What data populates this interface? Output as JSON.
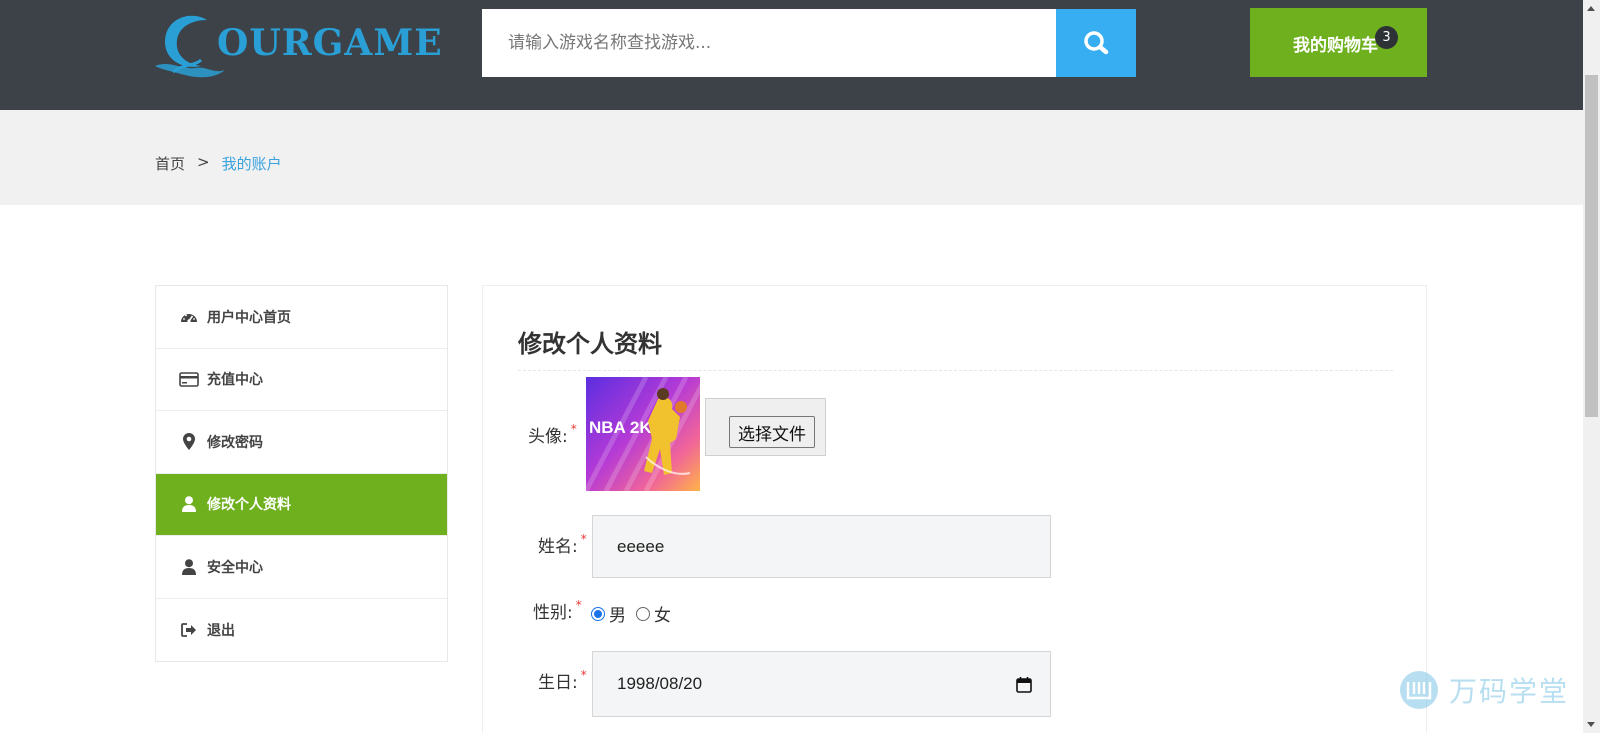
{
  "header": {
    "logo_text": "OURGAME",
    "search_placeholder": "请输入游戏名称查找游戏...",
    "cart_label": "我的购物车",
    "cart_count": "3",
    "brand_blue": "#37aef2",
    "brand_green": "#6fb01f",
    "header_bg": "#3c4248"
  },
  "breadcrumb": {
    "home": "首页",
    "separator": ">",
    "current": "我的账户"
  },
  "sidebar": {
    "items": [
      {
        "label": "用户中心首页",
        "icon": "dashboard-icon",
        "active": false
      },
      {
        "label": "充值中心",
        "icon": "credit-card-icon",
        "active": false
      },
      {
        "label": "修改密码",
        "icon": "map-marker-icon",
        "active": false
      },
      {
        "label": "修改个人资料",
        "icon": "user-icon",
        "active": true
      },
      {
        "label": "安全中心",
        "icon": "user-icon",
        "active": false
      },
      {
        "label": "退出",
        "icon": "sign-out-icon",
        "active": false
      }
    ]
  },
  "form": {
    "title": "修改个人资料",
    "avatar_label": "头像:",
    "file_button": "选择文件",
    "name_label": "姓名:",
    "name_value": "eeeee",
    "gender_label": "性别:",
    "gender_options": [
      "男",
      "女"
    ],
    "gender_selected": "男",
    "birthday_label": "生日:",
    "birthday_value": "1998/08/20",
    "required_mark": "*",
    "avatar_logo_text": "NBA 2K24"
  },
  "watermark": {
    "text": "万码学堂"
  }
}
